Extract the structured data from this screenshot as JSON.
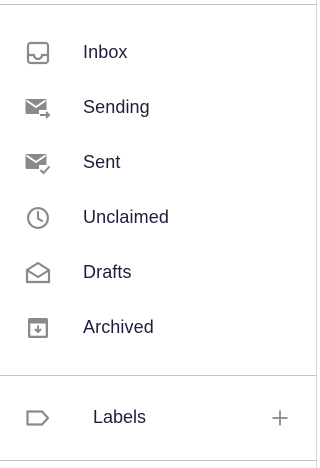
{
  "nav": {
    "items": [
      {
        "label": "Inbox",
        "icon": "inbox-icon"
      },
      {
        "label": "Sending",
        "icon": "mail-send-icon"
      },
      {
        "label": "Sent",
        "icon": "mail-check-icon"
      },
      {
        "label": "Unclaimed",
        "icon": "clock-icon"
      },
      {
        "label": "Drafts",
        "icon": "open-envelope-icon"
      },
      {
        "label": "Archived",
        "icon": "archive-icon"
      }
    ]
  },
  "labels_section": {
    "label": "Labels",
    "icon": "tag-icon",
    "add_icon": "plus-icon"
  },
  "colors": {
    "icon_gray": "#8a8a8a",
    "text": "#1d1d3f",
    "divider": "#c4c4c4"
  }
}
